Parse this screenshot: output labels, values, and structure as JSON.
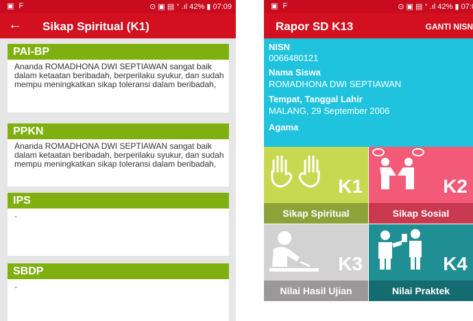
{
  "left_phone": {
    "status_bar": {
      "left_icons": "▣ F",
      "right": "⊙ ▣ ▤ ᐩ .ıl 42% ▮ 07:09"
    },
    "app_bar": {
      "back_icon": "arrow-left-icon",
      "title": "Sikap Spiritual (K1)"
    },
    "cards": [
      {
        "subject": "PAI-BP",
        "description": "Ananda ROMADHONA DWI SEPTIAWAN sangat baik dalam ketaatan beribadah, berperilaku syukur, dan sudah mempu meningkatkan sikap toleransi dalam beribadah,"
      },
      {
        "subject": "PPKN",
        "description": "Ananda ROMADHONA DWI SEPTIAWAN sangat baik dalam ketaatan beribadah, berperilaku syukur, dan sudah mempu meningkatkan sikap toleransi dalam beribadah,"
      },
      {
        "subject": "IPS",
        "description": "-"
      },
      {
        "subject": "SBDP",
        "description": "-"
      }
    ]
  },
  "right_phone": {
    "status_bar": {
      "left_icons": "▣ F",
      "right": "⊙ ▣ ▤ ᐩ .ıl 42% ▮ 07:0"
    },
    "app_bar": {
      "title": "Rapor SD K13",
      "action": "GANTI NISN"
    },
    "student": {
      "nisn_label": "NISN",
      "nisn_value": "0066480121",
      "name_label": "Nama Siswa",
      "name_value": "ROMADHONA DWI SEPTIAWAN",
      "birth_label": "Tempat, Tanggal Lahir",
      "birth_value": "MALANG, 29 September 2006",
      "religion_label": "Agama"
    },
    "tiles": [
      {
        "code": "K1",
        "label": "Sikap Spiritual",
        "color": "#c6d951",
        "label_color": "#8fa23a"
      },
      {
        "code": "K2",
        "label": "Sikap Sosial",
        "color": "#f25a78",
        "label_color": "#c8394f"
      },
      {
        "code": "K3",
        "label": "Nilai Hasil Ujian",
        "color": "#d3d2d2",
        "label_color": "#9a9898"
      },
      {
        "code": "K4",
        "label": "Nilai Praktek",
        "color": "#1f8f93",
        "label_color": "#156c70"
      }
    ]
  }
}
